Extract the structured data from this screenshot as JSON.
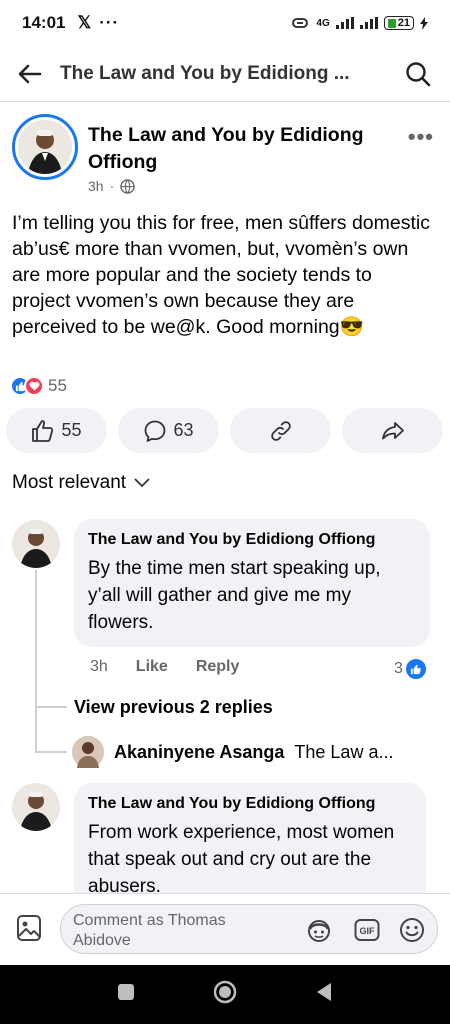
{
  "status_bar": {
    "time": "14:01",
    "x_logo": "𝕏",
    "dots": "···",
    "network": "4G",
    "battery": "21"
  },
  "header": {
    "title": "The Law and You by Edidiong ...",
    "back_icon": "arrow-left-icon",
    "search_icon": "search-icon"
  },
  "post": {
    "author": "The Law and You by Edidiong Offiong",
    "time": "3h",
    "dot": "·",
    "more": "•••",
    "text": "I’m telling you this for free, men sûffers domestic ab’us€ more than vvomen, but, vvomèn’s own are more popular and the society tends to project vvomen’s own because they are perceived to be we@k. Good morning😎",
    "reaction_count": "55",
    "likes_button_count": "55",
    "comments_button_count": "63"
  },
  "sort": {
    "label": "Most relevant"
  },
  "comments": [
    {
      "author": "The Law and You by Edidiong Offiong",
      "text": "By the time men start speaking up, y’all will gather and give me my flowers.",
      "time": "3h",
      "like_label": "Like",
      "reply_label": "Reply",
      "like_count": "3"
    },
    {
      "author": "The Law and You by Edidiong Offiong",
      "text": "From work experience, most women that speak out and cry out are the abusers."
    }
  ],
  "replies": {
    "view_previous": "View previous 2 replies",
    "latest_author": "Akaninyene Asanga",
    "latest_preview": "The Law a..."
  },
  "composer": {
    "placeholder": "Comment as Thomas Abidove"
  },
  "colors": {
    "accent": "#1877f2",
    "love": "#f33e58",
    "bubble": "#f0f2f5",
    "muted": "#65676b"
  }
}
